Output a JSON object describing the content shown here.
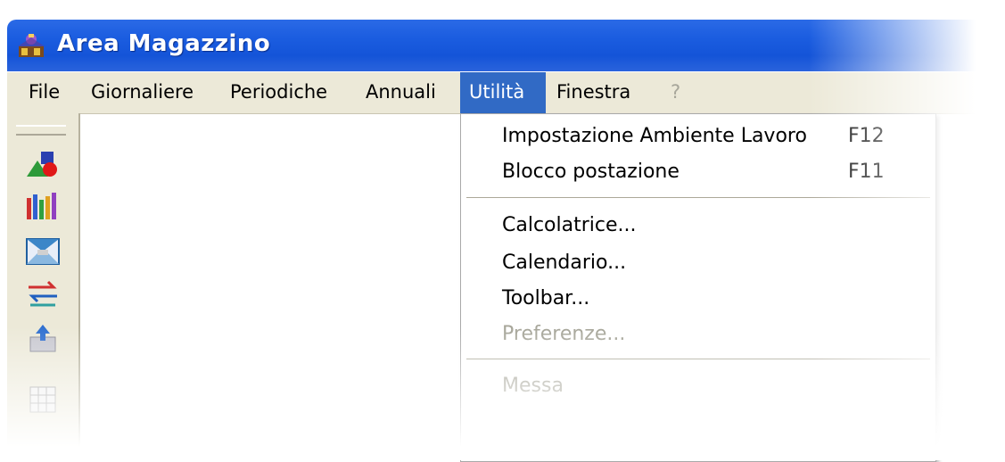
{
  "window": {
    "title": "Area Magazzino",
    "icon": "warehouse-app-icon"
  },
  "menubar": {
    "items": [
      {
        "label": "File",
        "state": "normal"
      },
      {
        "label": "Giornaliere",
        "state": "normal"
      },
      {
        "label": "Periodiche",
        "state": "normal"
      },
      {
        "label": "Annuali",
        "state": "normal"
      },
      {
        "label": "Utilità",
        "state": "active"
      },
      {
        "label": "Finestra",
        "state": "normal"
      },
      {
        "label": "?",
        "state": "disabled"
      }
    ]
  },
  "toolbar": {
    "icons": [
      "shapes-icon",
      "pencils-icon",
      "envelope-icon",
      "transfer-arrows-icon",
      "upload-box-icon",
      "grid-sheet-icon"
    ]
  },
  "dropdown": {
    "items": [
      {
        "label": "Impostazione Ambiente Lavoro",
        "shortcut": "F12",
        "enabled": true
      },
      {
        "label": "Blocco postazione",
        "shortcut": "F11",
        "enabled": true
      },
      {
        "label": "Calcolatrice...",
        "shortcut": "",
        "enabled": true
      },
      {
        "label": "Calendario...",
        "shortcut": "",
        "enabled": true
      },
      {
        "label": "Toolbar...",
        "shortcut": "",
        "enabled": true
      },
      {
        "label": "Preferenze...",
        "shortcut": "",
        "enabled": false
      },
      {
        "label": "Messa",
        "shortcut": "",
        "enabled": false
      }
    ]
  },
  "colors": {
    "titlebar": "#1b5de0",
    "menubar": "#ece9d8",
    "menu_highlight": "#316ac5",
    "disabled_text": "#a7a69a"
  }
}
